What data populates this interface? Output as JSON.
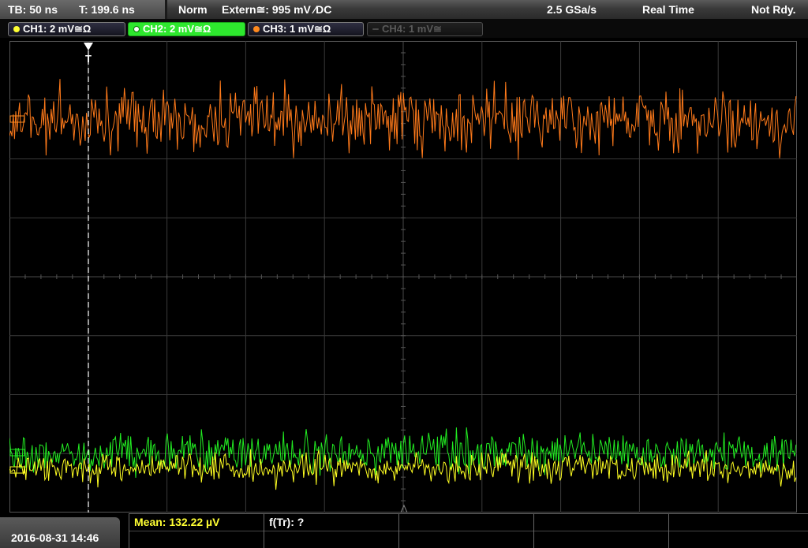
{
  "topbar": {
    "timebase": "TB: 50 ns",
    "trigger_time": "T: 199.6 ns",
    "mode": "Norm",
    "trigger": "Extern≅: 995 mV ⁄DC",
    "sample_rate": "2.5 GSa/s",
    "acq_mode": "Real Time",
    "status": "Not Rdy."
  },
  "channels": [
    {
      "label": "CH1: 2 mV≅Ω",
      "color": "#ffff33",
      "state": "on"
    },
    {
      "label": "CH2: 2 mV≅Ω",
      "color": "#22ee22",
      "state": "selected"
    },
    {
      "label": "CH3: 1 mV≅Ω",
      "color": "#ff8a1e",
      "state": "on"
    },
    {
      "label": "CH4: 1 mV≅",
      "color": "#555555",
      "state": "off"
    }
  ],
  "trigger_marker": "T",
  "traces": {
    "ch3_color": "#ff7a1a",
    "ch2_color": "#22ee22",
    "ch1_color": "#ffff22",
    "grid_color": "#3a3a3a"
  },
  "bottom": {
    "datetime": "2016-08-31 14:46",
    "meas1": "Mean: 132.22 µV",
    "meas1_color": "#ffff33",
    "meas2": "f(Tr): ?"
  }
}
